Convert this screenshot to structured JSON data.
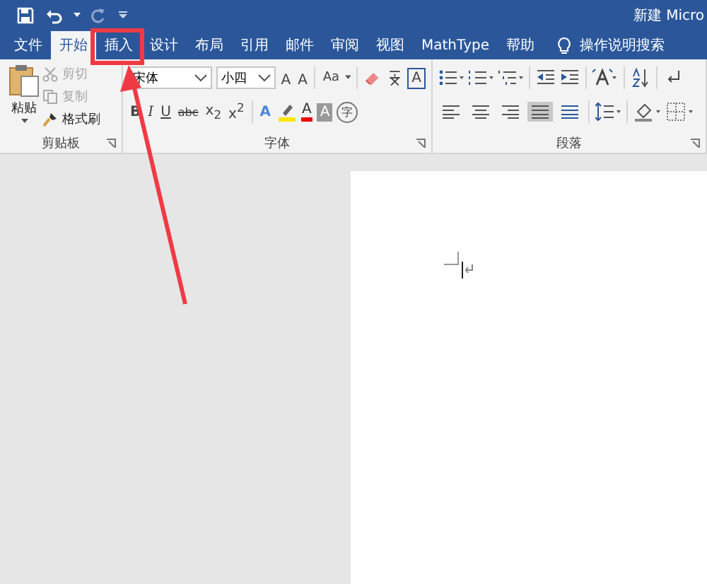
{
  "window": {
    "title": "新建 Micro"
  },
  "tabs": [
    {
      "label": "文件",
      "selected": false
    },
    {
      "label": "开始",
      "selected": true
    },
    {
      "label": "插入",
      "selected": false
    },
    {
      "label": "设计",
      "selected": false
    },
    {
      "label": "布局",
      "selected": false
    },
    {
      "label": "引用",
      "selected": false
    },
    {
      "label": "邮件",
      "selected": false
    },
    {
      "label": "审阅",
      "selected": false
    },
    {
      "label": "视图",
      "selected": false
    },
    {
      "label": "MathType",
      "selected": false
    },
    {
      "label": "帮助",
      "selected": false
    }
  ],
  "tell_me": {
    "label": "操作说明搜索"
  },
  "clipboard": {
    "paste": "粘贴",
    "items": [
      {
        "label": "剪切",
        "disabled": true
      },
      {
        "label": "复制",
        "disabled": true
      },
      {
        "label": "格式刷",
        "disabled": false
      }
    ],
    "group_label": "剪贴板"
  },
  "font": {
    "name": "宋体",
    "size": "小四",
    "size_buttons": [
      "A",
      "A"
    ],
    "case_button": "Aa",
    "boxed_button": "A",
    "format_buttons": [
      "B",
      "I",
      "U",
      "abc",
      "x$_{2}$",
      "x$^{2}$"
    ],
    "effect_buttons": [
      "A",
      "A",
      "A"
    ],
    "enclose_button": "字",
    "group_label": "字体"
  },
  "paragraph": {
    "alignments": [
      {
        "selected": false
      },
      {
        "selected": false
      },
      {
        "selected": false
      },
      {
        "selected": true
      },
      {
        "selected": false
      }
    ],
    "group_label": "段落"
  }
}
